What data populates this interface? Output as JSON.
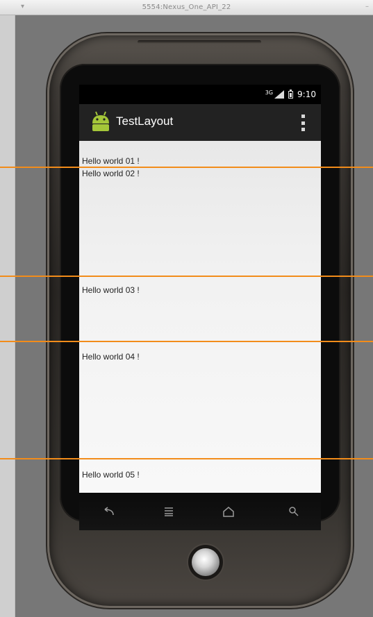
{
  "window": {
    "title": "5554:Nexus_One_API_22"
  },
  "status_bar": {
    "network": "3G",
    "time": "9:10"
  },
  "action_bar": {
    "title": "TestLayout",
    "icon": "android-robot-icon",
    "menu_icon": "overflow-menu-icon"
  },
  "content": {
    "items": [
      {
        "text": "Hello world 01 !"
      },
      {
        "text": "Hello world 02 !"
      },
      {
        "text": "Hello world 03 !"
      },
      {
        "text": "Hello world 04 !"
      },
      {
        "text": "Hello world 05 !"
      }
    ]
  },
  "nav_bar": {
    "buttons": [
      "back-icon",
      "menu-icon",
      "home-icon",
      "search-icon"
    ]
  },
  "colors": {
    "guide_line": "#f28c1a",
    "android_green": "#a4c639",
    "action_bar": "#222222"
  }
}
